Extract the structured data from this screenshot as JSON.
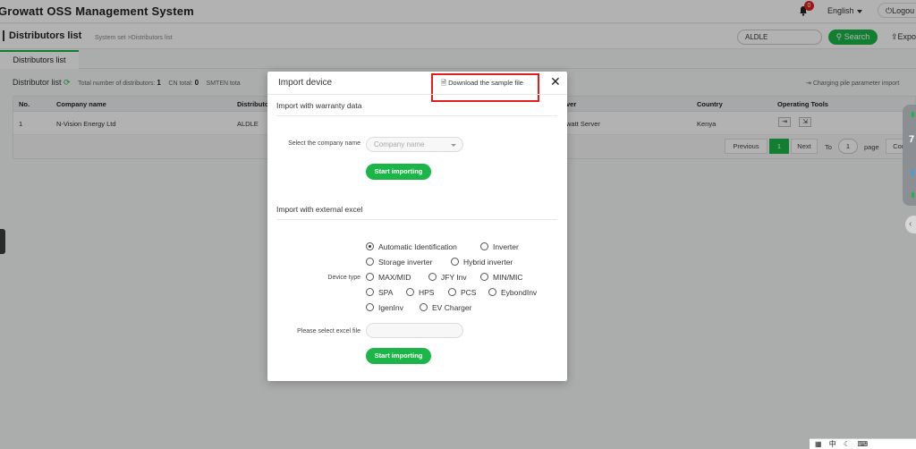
{
  "app": {
    "title": "Growatt OSS Management System",
    "notification_count": "0",
    "language": "English",
    "logout_label": "Logou"
  },
  "page": {
    "title": "Distributors list",
    "breadcrumb": "System set >Distributors list",
    "search_value": "ALDLE",
    "search_label": "Search",
    "export_label": "Expo",
    "tab_label": "Distributors list"
  },
  "list": {
    "heading": "Distributor list",
    "total_label": "Total number of distributors:",
    "total_value": "1",
    "cn_label": "CN total:",
    "cn_value": "0",
    "smten_label": "SMTEN tota",
    "charging_link": "Charging pile parameter import",
    "columns": [
      "No.",
      "Company name",
      "Distributo",
      "ver",
      "Country",
      "Operating Tools"
    ],
    "rows": [
      {
        "no": "1",
        "company": "N-Vision Energy Ltd",
        "distributor": "ALDLE",
        "server": "watt Server",
        "country": "Kenya"
      }
    ]
  },
  "pager": {
    "previous": "Previous",
    "current_page": "1",
    "next": "Next",
    "to_label": "To",
    "page_input": "1",
    "page_label": "page",
    "confirm": "Confi"
  },
  "side": {
    "number": "7"
  },
  "modal": {
    "title": "Import device",
    "download_label": "Download the sample file",
    "section1_title": "Import with warranty data",
    "company_label": "Select the company name",
    "company_placeholder": "Company name",
    "start_label_1": "Start importing",
    "section2_title": "Import with external excel",
    "device_type_label": "Device type",
    "device_types": [
      "Automatic Identification",
      "Inverter",
      "Storage inverter",
      "Hybrid inverter",
      "MAX/MID",
      "JFY Inv",
      "MIN/MIC",
      "SPA",
      "HPS",
      "PCS",
      "EybondInv",
      "IgenInv",
      "EV Charger"
    ],
    "selected_device_type": "Automatic Identification",
    "excel_label": "Please select excel file",
    "start_label_2": "Start importing"
  },
  "taskbar": {
    "ime_label": "中"
  },
  "colors": {
    "accent_green": "#1bb548",
    "highlight_red": "#e51c1c",
    "badge_red": "#e02020"
  },
  "icons": [
    "bell-icon",
    "caret-down-icon",
    "power-icon",
    "search-icon",
    "export-icon",
    "refresh-icon",
    "document-icon",
    "close-icon",
    "chevron-left-icon"
  ]
}
